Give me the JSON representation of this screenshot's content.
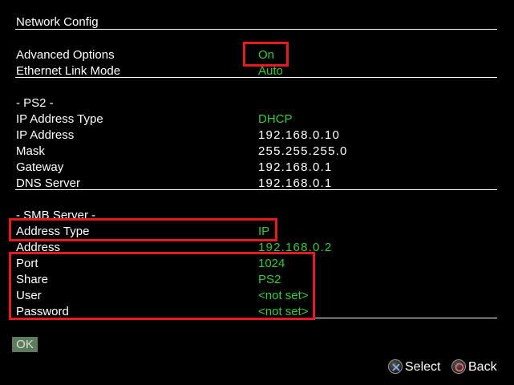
{
  "title": "Network Config",
  "general": [
    {
      "label": "Advanced Options",
      "value": "On"
    },
    {
      "label": "Ethernet Link Mode",
      "value": "Auto"
    }
  ],
  "ps2": {
    "heading": "- PS2 -",
    "rows": [
      {
        "label": "IP Address Type",
        "value": "DHCP"
      },
      {
        "label": "IP Address",
        "value": "192.168.0.10"
      },
      {
        "label": "Mask",
        "value": "255.255.255.0"
      },
      {
        "label": "Gateway",
        "value": "192.168.0.1"
      },
      {
        "label": "DNS Server",
        "value": "192.168.0.1"
      }
    ]
  },
  "smb": {
    "heading": "- SMB Server -",
    "rows": [
      {
        "label": "Address Type",
        "value": "IP"
      },
      {
        "label": "Address",
        "value": "192.168.0.2"
      },
      {
        "label": "Port",
        "value": "1024"
      },
      {
        "label": "Share",
        "value": "PS2"
      },
      {
        "label": "User",
        "value": "<not set>"
      },
      {
        "label": "Password",
        "value": "<not set>"
      }
    ]
  },
  "ok_label": "OK",
  "footer": {
    "select_label": "Select",
    "select_icon": "cross-button-icon",
    "back_label": "Back",
    "back_icon": "circle-button-icon"
  },
  "colors": {
    "value_green": "#33cc33",
    "highlight_red": "#e41b23",
    "background": "#000000"
  }
}
